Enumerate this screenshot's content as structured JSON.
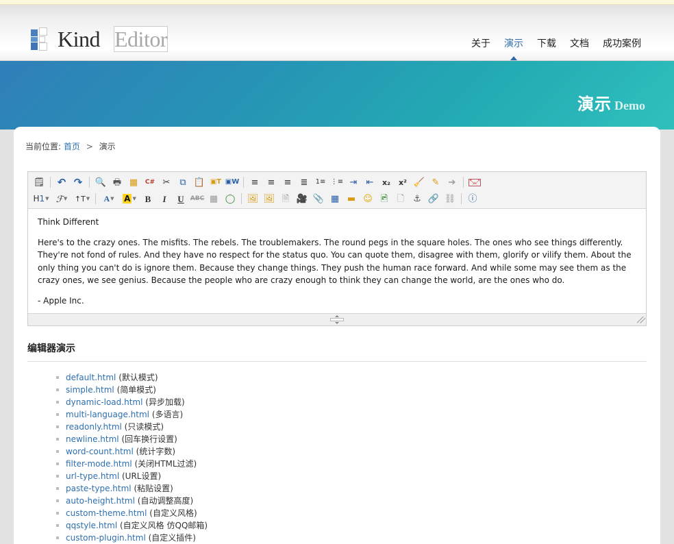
{
  "header": {
    "logo": {
      "kind": "Kind",
      "editor": "Editor"
    },
    "nav": [
      {
        "label": "关于",
        "active": false
      },
      {
        "label": "演示",
        "active": true
      },
      {
        "label": "下载",
        "active": false
      },
      {
        "label": "文档",
        "active": false
      },
      {
        "label": "成功案例",
        "active": false
      }
    ]
  },
  "banner": {
    "title_cn": "演示",
    "title_en": "Demo"
  },
  "breadcrumb": {
    "prefix": "当前位置:",
    "home": "首页",
    "sep": ">",
    "current": "演示"
  },
  "toolbar": {
    "row1": [
      {
        "name": "source-icon",
        "glyph": "▤",
        "title": "HTML源码"
      },
      {
        "name": "separator",
        "glyph": ""
      },
      {
        "name": "undo-icon",
        "glyph": "↺",
        "title": "后退"
      },
      {
        "name": "redo-icon",
        "glyph": "↻",
        "title": "前进"
      },
      {
        "name": "separator",
        "glyph": ""
      },
      {
        "name": "preview-icon",
        "glyph": "🔍",
        "title": "预览"
      },
      {
        "name": "print-icon",
        "glyph": "🖶",
        "title": "打印"
      },
      {
        "name": "template-icon",
        "glyph": "▤",
        "title": "模板"
      },
      {
        "name": "code-icon",
        "glyph": "C#",
        "title": "插入程序代码"
      },
      {
        "name": "cut-icon",
        "glyph": "✂",
        "title": "剪切"
      },
      {
        "name": "copy-icon",
        "glyph": "⧉",
        "title": "复制"
      },
      {
        "name": "paste-icon",
        "glyph": "📋",
        "title": "粘贴"
      },
      {
        "name": "paste-text-icon",
        "glyph": "T",
        "title": "粘贴为无格式文本"
      },
      {
        "name": "paste-word-icon",
        "glyph": "W",
        "title": "从Word粘贴"
      },
      {
        "name": "separator",
        "glyph": ""
      },
      {
        "name": "justify-left-icon",
        "glyph": "≡",
        "title": "左对齐"
      },
      {
        "name": "justify-center-icon",
        "glyph": "≡",
        "title": "居中"
      },
      {
        "name": "justify-right-icon",
        "glyph": "≡",
        "title": "右对齐"
      },
      {
        "name": "justify-full-icon",
        "glyph": "≡",
        "title": "两端对齐"
      },
      {
        "name": "ordered-list-icon",
        "glyph": "≔",
        "title": "编号"
      },
      {
        "name": "unordered-list-icon",
        "glyph": "⁝≡",
        "title": "项目符号"
      },
      {
        "name": "indent-icon",
        "glyph": "⇥",
        "title": "增加缩进"
      },
      {
        "name": "outdent-icon",
        "glyph": "⇤",
        "title": "减少缩进"
      },
      {
        "name": "subscript-icon",
        "glyph": "x₂",
        "title": "下标"
      },
      {
        "name": "superscript-icon",
        "glyph": "x²",
        "title": "上标"
      },
      {
        "name": "clean-format-icon",
        "glyph": "🧹",
        "title": "清理HTML代码"
      },
      {
        "name": "formatting-marks-icon",
        "glyph": "✎",
        "title": "显示段落标记"
      },
      {
        "name": "select-all-icon",
        "glyph": "↖",
        "title": "全选"
      },
      {
        "name": "separator",
        "glyph": ""
      },
      {
        "name": "fullscreen-icon",
        "glyph": "⤢",
        "title": "全屏显示"
      }
    ],
    "row2": [
      {
        "name": "paragraph-style-select",
        "glyph": "H1",
        "title": "段落",
        "caret": true
      },
      {
        "name": "font-family-select",
        "glyph": "ℱ",
        "title": "字体",
        "caret": true
      },
      {
        "name": "font-size-select",
        "glyph": "↑T",
        "title": "文字大小",
        "caret": true
      },
      {
        "name": "separator",
        "glyph": ""
      },
      {
        "name": "text-color-picker",
        "glyph": "A",
        "title": "文字颜色",
        "caret": true
      },
      {
        "name": "background-color-picker",
        "glyph": "A",
        "title": "文字背景",
        "caret": true
      },
      {
        "name": "bold-icon",
        "glyph": "B",
        "title": "粗体"
      },
      {
        "name": "italic-icon",
        "glyph": "I",
        "title": "斜体"
      },
      {
        "name": "underline-icon",
        "glyph": "U",
        "title": "下划线"
      },
      {
        "name": "strikethrough-icon",
        "glyph": "ABC",
        "title": "删除线"
      },
      {
        "name": "remove-format-icon",
        "glyph": "▦",
        "title": "删除格式"
      },
      {
        "name": "eraser-icon",
        "glyph": "⌫",
        "title": "清除"
      },
      {
        "name": "separator",
        "glyph": ""
      },
      {
        "name": "image-icon",
        "glyph": "🖼",
        "title": "图片"
      },
      {
        "name": "multi-image-icon",
        "glyph": "🖼",
        "title": "批量图片上传"
      },
      {
        "name": "flash-icon",
        "glyph": "🗎",
        "title": "Flash"
      },
      {
        "name": "media-icon",
        "glyph": "🎥",
        "title": "视音频"
      },
      {
        "name": "file-icon",
        "glyph": "📎",
        "title": "插入文件"
      },
      {
        "name": "table-icon",
        "glyph": "▦",
        "title": "表格"
      },
      {
        "name": "hr-icon",
        "glyph": "▬",
        "title": "插入横线"
      },
      {
        "name": "emoticons-icon",
        "glyph": "☺",
        "title": "插入表情"
      },
      {
        "name": "pagebreak-icon",
        "glyph": "🖻",
        "title": "插入分页符"
      },
      {
        "name": "doc-icon",
        "glyph": "🗋",
        "title": "文档"
      },
      {
        "name": "anchor-icon",
        "glyph": "⚓",
        "title": "锚点"
      },
      {
        "name": "link-icon",
        "glyph": "🔗",
        "title": "超级链接"
      },
      {
        "name": "unlink-icon",
        "glyph": "⛓",
        "title": "取消超级链接"
      },
      {
        "name": "separator",
        "glyph": ""
      },
      {
        "name": "help-icon",
        "glyph": "?",
        "title": "关于"
      }
    ]
  },
  "editor_content": {
    "heading": "Think Different",
    "paragraph": "Here's to the crazy ones. The misfits. The rebels. The troublemakers. The round pegs in the square holes. The ones who see things differently. They're not fond of rules. And they have no respect for the status quo. You can quote them, disagree with them, glorify or vilify them. About the only thing you can't do is ignore them. Because they change things. They push the human race forward. And while some may see them as the crazy ones, we see genius. Because the people who are crazy enough to think they can change the world, are the ones who do.",
    "attribution": "- Apple Inc."
  },
  "demo_section": {
    "title": "编辑器演示",
    "items": [
      {
        "link": "default.html",
        "note": "(默认模式)"
      },
      {
        "link": "simple.html",
        "note": "(简单模式)"
      },
      {
        "link": "dynamic-load.html",
        "note": "(异步加载)"
      },
      {
        "link": "multi-language.html",
        "note": "(多语言)"
      },
      {
        "link": "readonly.html",
        "note": "(只读模式)"
      },
      {
        "link": "newline.html",
        "note": "(回车换行设置)"
      },
      {
        "link": "word-count.html",
        "note": "(统计字数)"
      },
      {
        "link": "filter-mode.html",
        "note": "(关闭HTML过滤)"
      },
      {
        "link": "url-type.html",
        "note": "(URL设置)"
      },
      {
        "link": "paste-type.html",
        "note": "(粘贴设置)"
      },
      {
        "link": "auto-height.html",
        "note": "(自动调整高度)"
      },
      {
        "link": "custom-theme.html",
        "note": "(自定义风格)"
      },
      {
        "link": "qqstyle.html",
        "note": "(自定义风格 仿QQ邮箱)"
      },
      {
        "link": "custom-plugin.html",
        "note": "(自定义插件)"
      }
    ]
  },
  "colors": {
    "accent": "#2d6fb0",
    "banner_start": "#2f7fb8",
    "banner_end": "#2fc0bd",
    "top_strip": "#fdf8db"
  }
}
